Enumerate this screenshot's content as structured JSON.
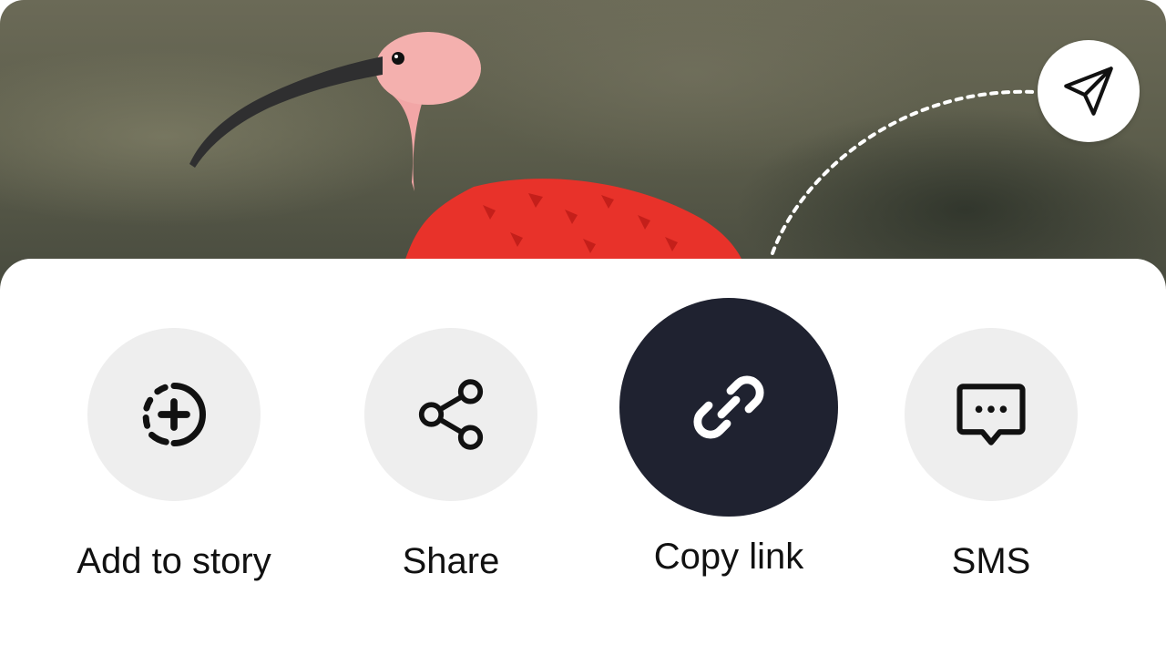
{
  "send_button": {
    "icon": "paper-plane-icon"
  },
  "actions": [
    {
      "id": "add-to-story",
      "label": "Add to story",
      "icon": "story-add-icon",
      "style": "light"
    },
    {
      "id": "share",
      "label": "Share",
      "icon": "share-nodes-icon",
      "style": "light"
    },
    {
      "id": "copy-link",
      "label": "Copy link",
      "icon": "link-icon",
      "style": "dark"
    },
    {
      "id": "sms",
      "label": "SMS",
      "icon": "message-dots-icon",
      "style": "light"
    }
  ],
  "colors": {
    "sheet": "#ffffff",
    "circle_light": "#eeeeee",
    "circle_dark": "#1f2230",
    "label_text": "#111111"
  }
}
